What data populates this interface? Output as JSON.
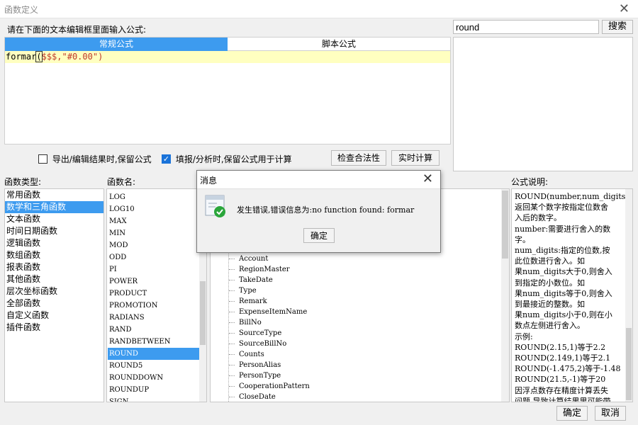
{
  "window": {
    "title": "函数定义",
    "close_icon": "close-icon"
  },
  "editor": {
    "instruction": "请在下面的文本编辑框里面输入公式:",
    "tabs": [
      {
        "label": "常规公式",
        "active": true
      },
      {
        "label": "脚本公式",
        "active": false
      }
    ],
    "formula_fn": "formar",
    "formula_open": "(",
    "formula_args": "$$$,\"#0.00\")",
    "highlight_color": "#ffffc0",
    "keep_formula_export_label": "导出/编辑结果时,保留公式",
    "keep_formula_export_checked": false,
    "keep_formula_fill_label": "填报/分析时,保留公式用于计算",
    "keep_formula_fill_checked": true,
    "check_button": "检查合法性",
    "realtime_button": "实时计算"
  },
  "search": {
    "value": "round",
    "button": "搜索"
  },
  "categories": {
    "label": "函数类型:",
    "items": [
      "常用函数",
      "数学和三角函数",
      "文本函数",
      "时间日期函数",
      "逻辑函数",
      "数组函数",
      "报表函数",
      "其他函数",
      "层次坐标函数",
      "全部函数",
      "自定义函数",
      "插件函数"
    ],
    "selected_index": 1
  },
  "functions": {
    "label": "函数名:",
    "items": [
      "LOG",
      "LOG10",
      "MAX",
      "MIN",
      "MOD",
      "ODD",
      "PI",
      "POWER",
      "PRODUCT",
      "PROMOTION",
      "RADIANS",
      "RAND",
      "RANDBETWEEN",
      "ROUND",
      "ROUND5",
      "ROUNDDOWN",
      "ROUNDUP",
      "SIGN"
    ],
    "selected_index": 13
  },
  "fields": {
    "items": [
      "Account",
      "RegionMaster",
      "TakeDate",
      "Type",
      "Remark",
      "ExpenseItemName",
      "BillNo",
      "SourceType",
      "SourceBillNo",
      "Counts",
      "PersonAlias",
      "PersonType",
      "CooperationPattern",
      "CloseDate"
    ]
  },
  "description": {
    "label": "公式说明:",
    "lines": [
      "ROUND(number,num_digits):",
      "返回某个数字按指定位数舍",
      "入后的数字。",
      "number:需要进行舍入的数",
      "字。",
      "num_digits:指定的位数,按",
      "此位数进行舍入。如",
      "果num_digits大于0,则舍入",
      "到指定的小数位。如",
      "果num_digits等于0,则舍入",
      "到最接近的整数。如",
      "果num_digits小于0,则在小",
      "数点左侧进行舍入。",
      "示例:",
      "ROUND(2.15,1)等于2.2",
      "ROUND(2.149,1)等于2.1",
      "ROUND(-1.475,2)等于-1.48",
      "ROUND(21.5,-1)等于20",
      "因浮点数存在精度计算丢失",
      "问题,导致计算结果里可能带"
    ]
  },
  "footer": {
    "ok": "确定",
    "cancel": "取消"
  },
  "message_dialog": {
    "title": "消息",
    "text": "发生错误,错误信息为:no function found: formar",
    "ok": "确定",
    "icon": "info-check-icon"
  },
  "colors": {
    "accent": "#3d9bef",
    "highlight": "#ffffc0",
    "check_green": "#2aa63b"
  }
}
